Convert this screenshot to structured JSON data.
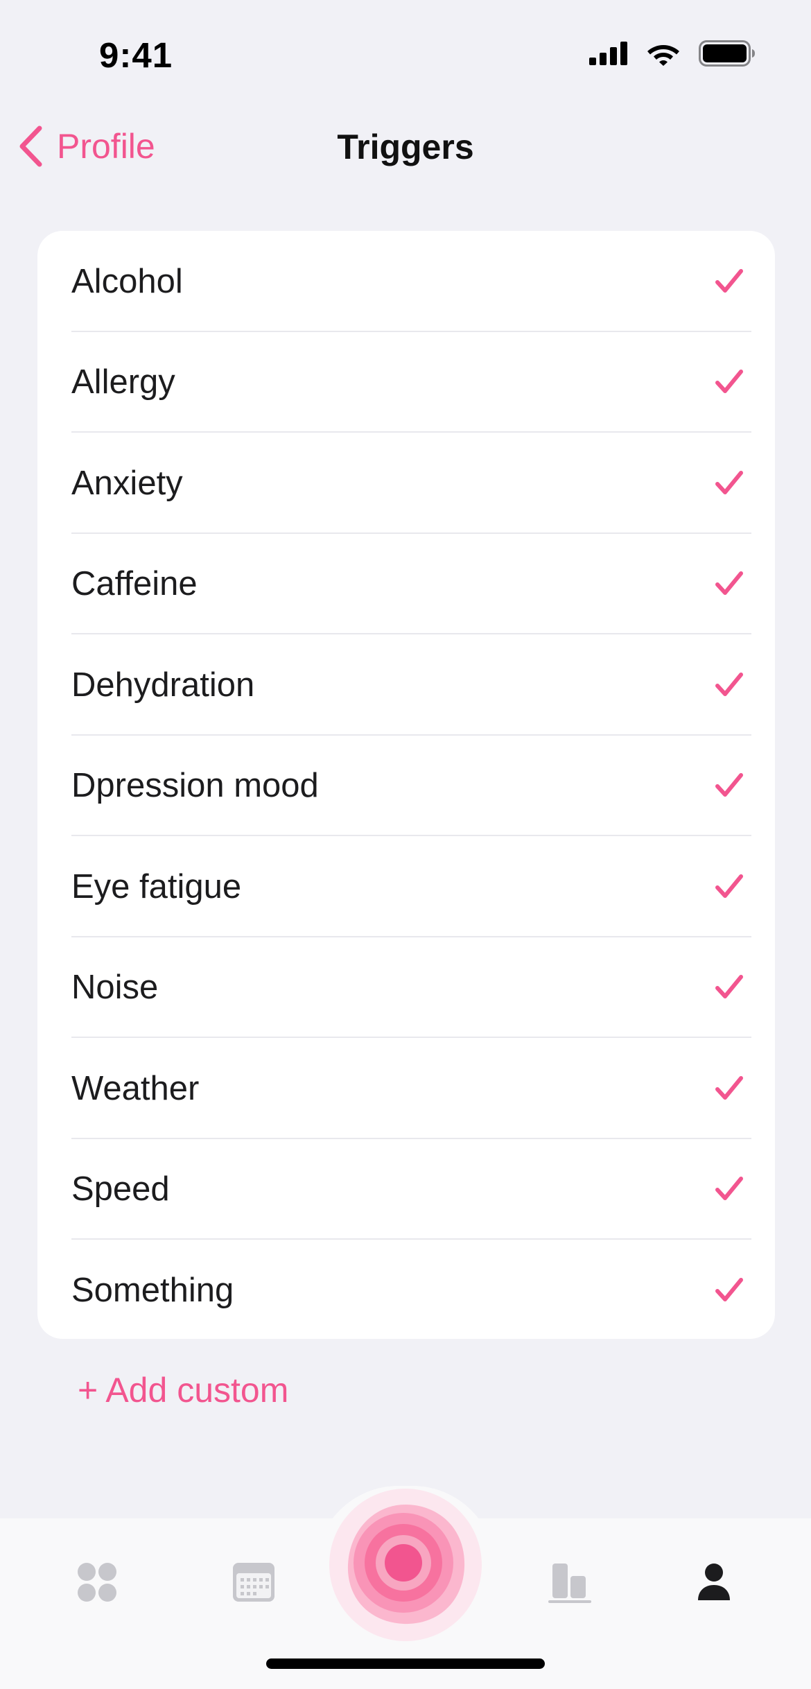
{
  "status_bar": {
    "time": "9:41"
  },
  "nav": {
    "back_label": "Profile",
    "title": "Triggers"
  },
  "triggers": [
    {
      "label": "Alcohol",
      "checked": true
    },
    {
      "label": "Allergy",
      "checked": true
    },
    {
      "label": "Anxiety",
      "checked": true
    },
    {
      "label": "Caffeine",
      "checked": true
    },
    {
      "label": "Dehydration",
      "checked": true
    },
    {
      "label": "Dpression mood",
      "checked": true
    },
    {
      "label": "Eye fatigue",
      "checked": true
    },
    {
      "label": "Noise",
      "checked": true
    },
    {
      "label": "Weather",
      "checked": true
    },
    {
      "label": "Speed",
      "checked": true
    },
    {
      "label": "Something",
      "checked": true
    }
  ],
  "add_custom_label": "+ Add custom",
  "tabbar": {
    "tabs": [
      {
        "name": "dashboard",
        "icon": "grid-icon"
      },
      {
        "name": "calendar",
        "icon": "calendar-icon"
      },
      {
        "name": "record",
        "icon": "record-pulse-icon"
      },
      {
        "name": "stats",
        "icon": "bar-chart-icon"
      },
      {
        "name": "profile",
        "icon": "person-icon"
      }
    ],
    "active": "profile"
  },
  "colors": {
    "accent": "#F2558F",
    "background": "#F1F1F6",
    "card": "#FFFFFF",
    "inactive_icon": "#C7C7CC"
  }
}
